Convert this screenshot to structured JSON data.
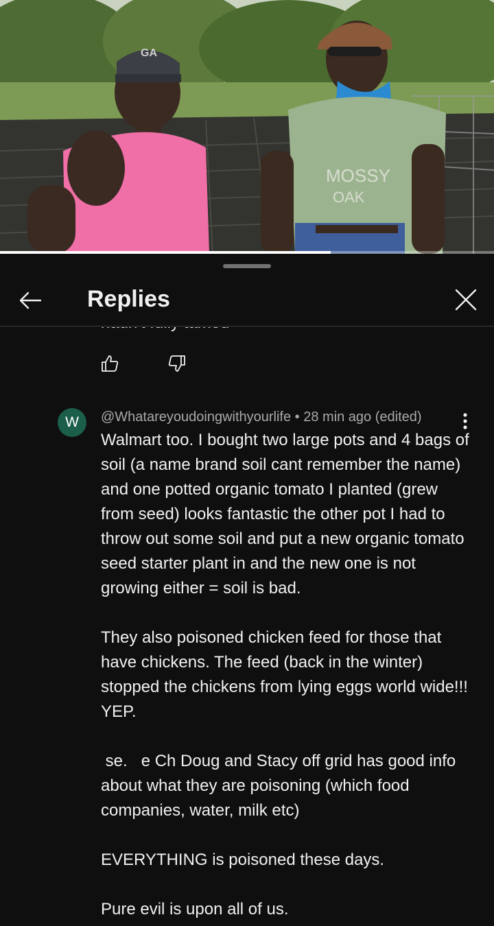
{
  "video": {
    "progress_fraction": 0.67
  },
  "sheet": {
    "title": "Replies",
    "back_icon": "arrow-left-icon",
    "close_icon": "close-icon",
    "previous_comment_tail": "hadn't fully tamed"
  },
  "comment": {
    "avatar_letter": "W",
    "avatar_color": "#1b5e4a",
    "author": "@Whatareyoudoingwithyourlife",
    "meta_suffix": " • 28 min ago (edited)",
    "paragraphs": [
      "Walmart too. I bought two large pots and 4 bags of soil (a name brand soil cant remember the name) and one potted organic tomato I planted (grew from seed) looks fantastic the other pot I had to throw out some soil and put a new organic tomato seed starter plant in and the new one is not growing either = soil is bad.",
      "They also poisoned chicken feed for those that have chickens. The feed (back in the winter) stopped the chickens from lying eggs world wide!!! YEP.",
      " se.   e Ch Doug and Stacy off grid has good info about what they are poisoning (which food companies, water, milk etc)",
      "EVERYTHING is poisoned these days.",
      "Pure evil is upon all of us."
    ]
  },
  "colors": {
    "background": "#0f0f0f",
    "text": "#f1f1f1",
    "secondary_text": "#aaaaaa"
  }
}
